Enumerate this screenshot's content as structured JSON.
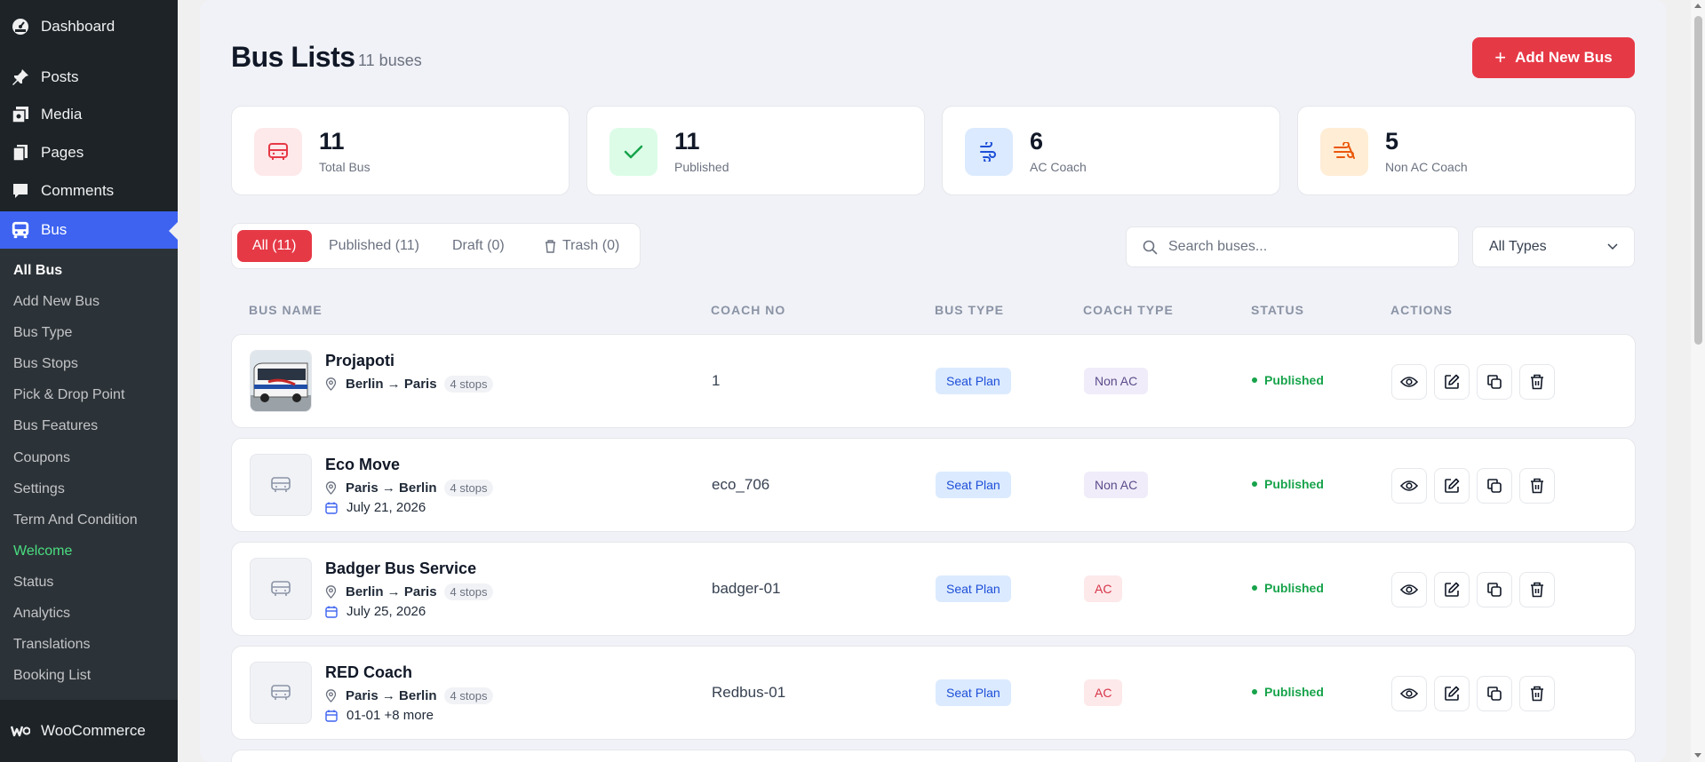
{
  "sidebar": {
    "menu": [
      {
        "label": "Dashboard",
        "icon": "dashboard-icon"
      },
      {
        "label": "Posts",
        "icon": "pin-icon"
      },
      {
        "label": "Media",
        "icon": "media-icon"
      },
      {
        "label": "Pages",
        "icon": "pages-icon"
      },
      {
        "label": "Comments",
        "icon": "comments-icon"
      },
      {
        "label": "Bus",
        "icon": "bus-icon"
      }
    ],
    "submenu": [
      "All Bus",
      "Add New Bus",
      "Bus Type",
      "Bus Stops",
      "Pick & Drop Point",
      "Bus Features",
      "Coupons",
      "Settings",
      "Term And Condition",
      "Welcome",
      "Status",
      "Analytics",
      "Translations",
      "Booking List"
    ],
    "woo": "WooCommerce"
  },
  "header": {
    "title": "Bus Lists",
    "count": "11 buses",
    "add_button": "Add New Bus"
  },
  "stats": [
    {
      "value": "11",
      "label": "Total Bus"
    },
    {
      "value": "11",
      "label": "Published"
    },
    {
      "value": "6",
      "label": "AC Coach"
    },
    {
      "value": "5",
      "label": "Non AC Coach"
    }
  ],
  "tabs": [
    "All (11)",
    "Published (11)",
    "Draft (0)",
    "Trash (0)"
  ],
  "search": {
    "placeholder": "Search buses..."
  },
  "filter": {
    "selected": "All Types"
  },
  "table": {
    "headers": [
      "BUS NAME",
      "COACH NO",
      "BUS TYPE",
      "COACH TYPE",
      "STATUS",
      "ACTIONS"
    ],
    "rows": [
      {
        "name": "Projapoti",
        "route": "Berlin → Paris",
        "stops": "4 stops",
        "date": "",
        "coach_no": "1",
        "bus_type": "Seat Plan",
        "coach_type": "Non AC",
        "status": "Published"
      },
      {
        "name": "Eco Move",
        "route": "Paris → Berlin",
        "stops": "4 stops",
        "date": "July 21, 2026",
        "coach_no": "eco_706",
        "bus_type": "Seat Plan",
        "coach_type": "Non AC",
        "status": "Published"
      },
      {
        "name": "Badger Bus Service",
        "route": "Berlin → Paris",
        "stops": "4 stops",
        "date": "July 25, 2026",
        "coach_no": "badger-01",
        "bus_type": "Seat Plan",
        "coach_type": "AC",
        "status": "Published"
      },
      {
        "name": "RED Coach",
        "route": "Paris → Berlin",
        "stops": "4 stops",
        "date": "01-01 +8 more",
        "coach_no": "Redbus-01",
        "bus_type": "Seat Plan",
        "coach_type": "AC",
        "status": "Published"
      }
    ]
  },
  "colors": {
    "accent": "#e63946",
    "sidebar_active": "#3d63f0",
    "status_green": "#16a34a"
  }
}
